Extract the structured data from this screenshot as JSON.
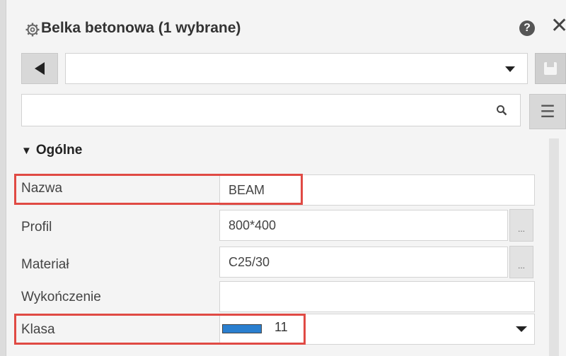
{
  "panel": {
    "title": "Belka betonowa (1 wybrane)",
    "help_label": "?",
    "close_label": "✕"
  },
  "toolbar": {
    "selector_value": "",
    "search_value": "",
    "search_placeholder": "",
    "menu_label": "☰"
  },
  "section": {
    "title": "Ogólne"
  },
  "properties": [
    {
      "label": "Nazwa",
      "value": "BEAM"
    },
    {
      "label": "Profil",
      "value": "800*400"
    },
    {
      "label": "Materiał",
      "value": "C25/30"
    },
    {
      "label": "Wykończenie",
      "value": ""
    },
    {
      "label": "Klasa",
      "value": "11"
    }
  ],
  "ellipsis_label": "...",
  "colors": {
    "highlight": "#e04a44",
    "class_swatch": "#2a7fcf"
  },
  "icons": [
    "gear-icon",
    "help-icon",
    "close-icon",
    "back-arrow-icon",
    "dropdown-caret-icon",
    "save-icon",
    "search-icon",
    "menu-icon",
    "collapse-triangle-icon"
  ]
}
